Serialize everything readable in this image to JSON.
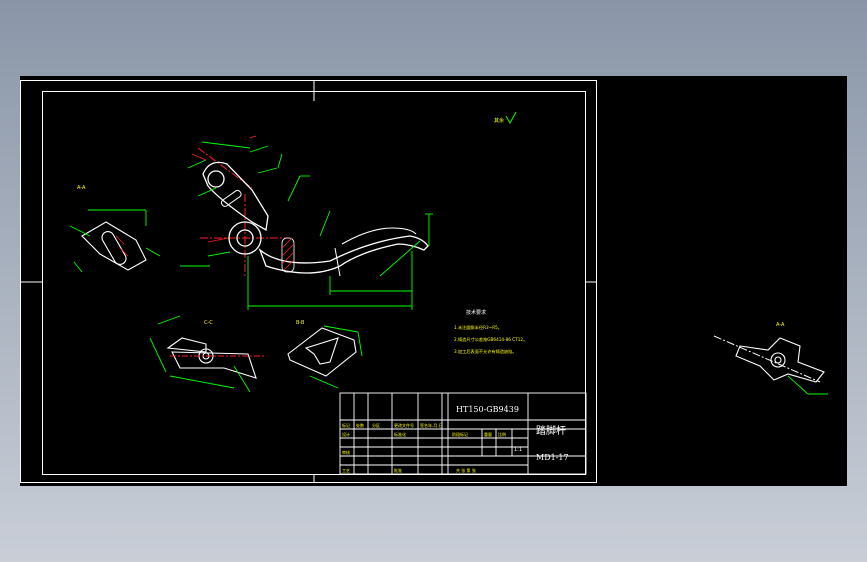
{
  "colors": {
    "background_gradient_top": "#8a96a8",
    "background_gradient_bottom": "#c9ced7",
    "canvas": "#000000",
    "frame": "#ffffff",
    "geometry": "#ffffff",
    "dimension": "#00ff00",
    "centerline": "#ff2020",
    "hatch": "#ff2020",
    "text_yellow": "#ffff00",
    "text_white": "#ffffff"
  },
  "drawing": {
    "title_block": {
      "material": "HT150-GB9439",
      "part_name": "踏脚杆",
      "drawing_number": "MD1-17",
      "scale": "1:1",
      "rows": {
        "r1": [
          "标记",
          "处数",
          "分区",
          "更改文件号",
          "签名",
          "年.月.日"
        ],
        "r2": [
          "设计",
          "",
          "标准化",
          "",
          "阶段标记",
          "重量",
          "比例"
        ],
        "r3": [
          "审核",
          ""
        ],
        "r4": [
          "工艺",
          "",
          "批准",
          "",
          "共 张 第 张"
        ]
      }
    },
    "tech_notes": {
      "title": "技术要求",
      "items": [
        "1.未注圆角半径R3~R5。",
        "2.铸造尺寸公差按GB6414-86 CT12。",
        "3.加工后表面不允许有铸造缺陷。"
      ]
    },
    "view_labels": {
      "section_ab": "A-A",
      "section_b": "B-B",
      "section_c": "C-C",
      "side_detail": "A-A"
    },
    "roughness_symbol": "其余"
  }
}
